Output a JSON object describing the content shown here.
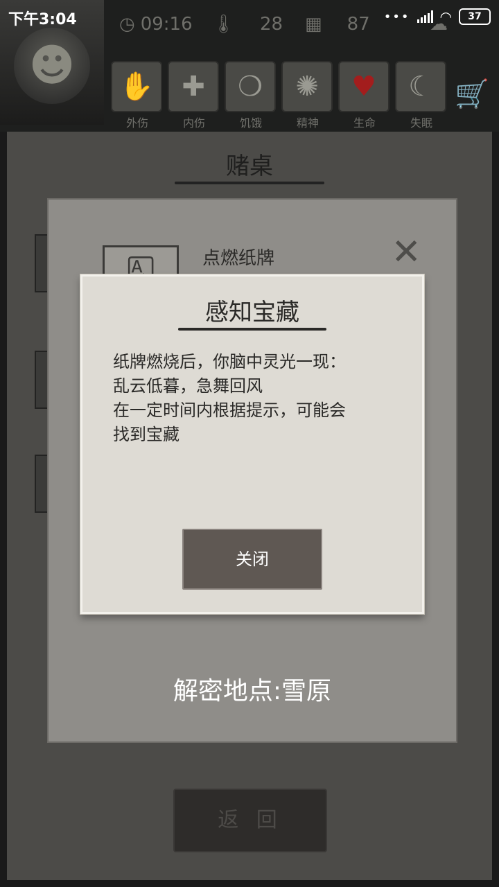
{
  "status_bar": {
    "time": "下午3:04",
    "battery": "37",
    "icons": [
      "more-dots-icon",
      "signal-icon",
      "wifi-icon",
      "battery-icon"
    ]
  },
  "hud": {
    "clock": "09:16",
    "temperature": "28",
    "day": "87",
    "stat_icons": [
      "clock-icon",
      "thermometer-icon",
      "calendar-icon",
      "weather-icon"
    ],
    "ailments": [
      {
        "label": "外伤",
        "icon": "hand-icon"
      },
      {
        "label": "内伤",
        "icon": "cross-icon"
      },
      {
        "label": "饥饿",
        "icon": "stomach-icon"
      },
      {
        "label": "精神",
        "icon": "mind-icon"
      },
      {
        "label": "生命",
        "icon": "heart-icon",
        "color": "#a31d1d"
      },
      {
        "label": "失眠",
        "icon": "moon-icon"
      }
    ]
  },
  "back_panel": {
    "title": "赌桌",
    "back_button": "返 回"
  },
  "middle_dialog": {
    "item_title": "点燃纸牌",
    "reveal_text": "解密地点:雪原"
  },
  "top_dialog": {
    "title": "感知宝藏",
    "body_lines": [
      "纸牌燃烧后，你脑中灵光一现：",
      "乱云低暮，急舞回风",
      "在一定时间内根据提示，可能会",
      "找到宝藏"
    ],
    "close_button": "关闭"
  },
  "colors": {
    "parchment": "#dedbd4",
    "button": "#5f5853",
    "dim_backdrop": "#4c4b48"
  }
}
